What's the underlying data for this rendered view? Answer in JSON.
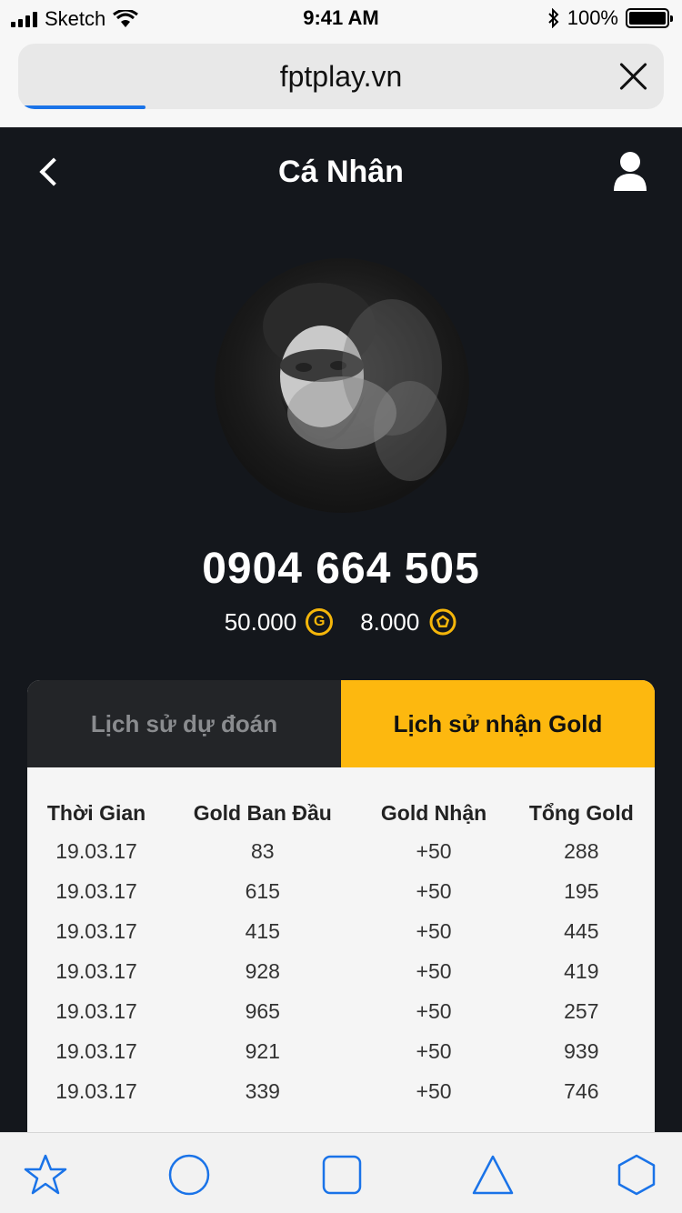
{
  "status_bar": {
    "carrier": "Sketch",
    "time": "9:41 AM",
    "battery": "100%"
  },
  "browser": {
    "url": "fptplay.vn"
  },
  "header": {
    "title": "Cá Nhân"
  },
  "profile": {
    "phone": "0904 664 505",
    "gold_balance": "50.000",
    "gold_icon_label": "G",
    "ball_balance": "8.000"
  },
  "tabs": [
    {
      "label": "Lịch sử dự đoán",
      "active": false
    },
    {
      "label": "Lịch sử nhận Gold",
      "active": true
    }
  ],
  "table": {
    "headers": [
      "Thời Gian",
      "Gold Ban Đầu",
      "Gold Nhận",
      "Tổng Gold"
    ],
    "rows": [
      [
        "19.03.17",
        "83",
        "+50",
        "288"
      ],
      [
        "19.03.17",
        "615",
        "+50",
        "195"
      ],
      [
        "19.03.17",
        "415",
        "+50",
        "445"
      ],
      [
        "19.03.17",
        "928",
        "+50",
        "419"
      ],
      [
        "19.03.17",
        "965",
        "+50",
        "257"
      ],
      [
        "19.03.17",
        "921",
        "+50",
        "939"
      ],
      [
        "19.03.17",
        "339",
        "+50",
        "746"
      ]
    ]
  },
  "toolbar_icons": [
    "star-icon",
    "circle-icon",
    "square-icon",
    "triangle-icon",
    "hexagon-icon"
  ],
  "colors": {
    "accent": "#fdb80f",
    "background": "#14171c",
    "toolbar_icon": "#1a73e8"
  }
}
